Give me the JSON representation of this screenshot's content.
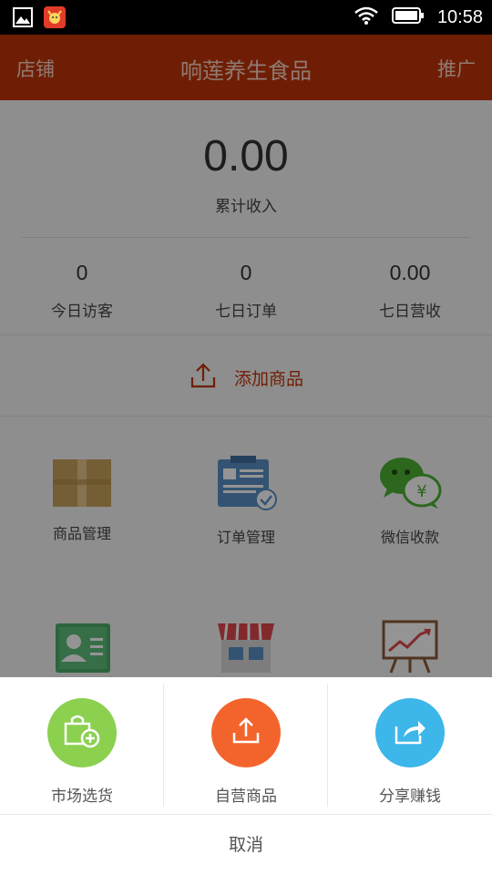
{
  "status_bar": {
    "time": "10:58",
    "icons": [
      "gallery-icon",
      "app-notification-icon",
      "wifi-icon",
      "battery-icon"
    ]
  },
  "header": {
    "left": "店铺",
    "title": "响莲养生食品",
    "right": "推广",
    "color": "#c0340a"
  },
  "stats": {
    "total_value": "0.00",
    "total_label": "累计收入",
    "items": [
      {
        "value": "0",
        "label": "今日访客"
      },
      {
        "value": "0",
        "label": "七日订单"
      },
      {
        "value": "0.00",
        "label": "七日营收"
      }
    ]
  },
  "add_product": {
    "label": "添加商品",
    "icon": "upload-icon"
  },
  "grid": {
    "items": [
      {
        "label": "商品管理",
        "icon": "box-icon"
      },
      {
        "label": "订单管理",
        "icon": "order-clipboard-icon"
      },
      {
        "label": "微信收款",
        "icon": "wechat-pay-icon"
      },
      {
        "label": "",
        "icon": "contact-card-icon"
      },
      {
        "label": "",
        "icon": "storefront-icon"
      },
      {
        "label": "",
        "icon": "chart-board-icon"
      }
    ]
  },
  "sheet": {
    "options": [
      {
        "label": "市场选货",
        "icon": "bag-add-icon",
        "color": "#8bd04f"
      },
      {
        "label": "自营商品",
        "icon": "upload-icon",
        "color": "#f3642d"
      },
      {
        "label": "分享赚钱",
        "icon": "share-icon",
        "color": "#3db6ea"
      }
    ],
    "cancel": "取消"
  }
}
